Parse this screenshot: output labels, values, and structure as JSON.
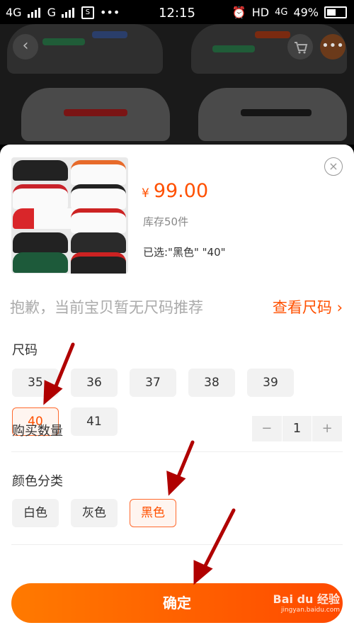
{
  "status_bar": {
    "network1": "4G",
    "network2": "G",
    "time": "12:15",
    "hd": "HD",
    "net4g": "4G",
    "battery": "49%"
  },
  "product": {
    "currency": "¥",
    "price": "99.00",
    "stock": "库存50件",
    "selected": "已选:\"黑色\" \"40\""
  },
  "size_tip": {
    "text": "抱歉，当前宝贝暂无尺码推荐",
    "link": "查看尺码 ›"
  },
  "size_section": {
    "title": "尺码",
    "options": [
      "35",
      "36",
      "37",
      "38",
      "39",
      "40",
      "41"
    ],
    "selected": "40"
  },
  "color_section": {
    "title": "颜色分类",
    "options": [
      "白色",
      "灰色",
      "黑色"
    ],
    "selected": "黑色"
  },
  "quantity": {
    "title": "购买数量",
    "minus": "−",
    "value": "1",
    "plus": "+"
  },
  "confirm_label": "确定",
  "watermark": {
    "brand": "Bai du 经验",
    "url": "jingyan.baidu.com"
  },
  "colors": {
    "accent": "#ff5000",
    "annotation_arrow": "#b00000"
  }
}
